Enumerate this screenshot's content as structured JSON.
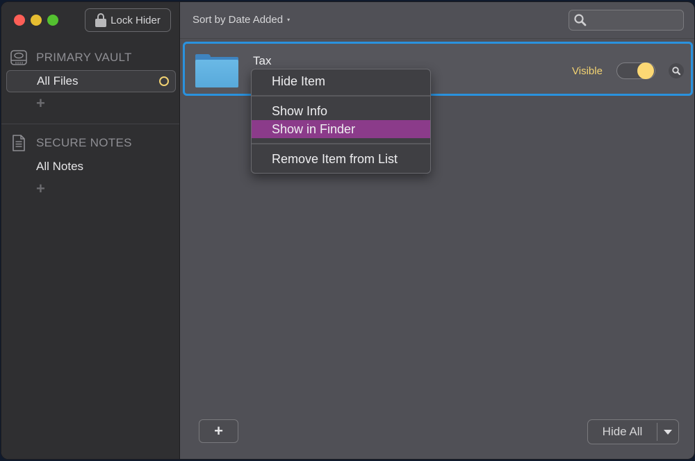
{
  "window": {
    "traffic_lights": [
      "close",
      "minimize",
      "zoom"
    ]
  },
  "toolbar": {
    "lock_label": "Lock Hider",
    "sort_label": "Sort by Date Added",
    "sort_caret": "▾",
    "search_placeholder": ""
  },
  "sidebar": {
    "sections": [
      {
        "title": "PRIMARY VAULT",
        "icon": "drive-icon",
        "items": [
          {
            "label": "All Files",
            "selected": true,
            "status": "partially-visible"
          }
        ],
        "add_label": "+"
      },
      {
        "title": "SECURE NOTES",
        "icon": "note-icon",
        "items": [
          {
            "label": "All Notes",
            "selected": false
          }
        ],
        "add_label": "+"
      }
    ]
  },
  "files": [
    {
      "name": "Tax",
      "type": "folder",
      "visibility_label": "Visible",
      "visible": true
    }
  ],
  "context_menu": {
    "items": [
      {
        "label": "Hide Item"
      },
      {
        "label": "Show Info"
      },
      {
        "label": "Show in Finder",
        "highlighted": true
      },
      {
        "label": "Remove Item from List"
      }
    ]
  },
  "footer": {
    "add_label": "+",
    "hide_all_label": "Hide All"
  },
  "colors": {
    "accent_selection": "#2a92de",
    "visible_yellow": "#f2d272",
    "menu_highlight": "#8b3b8a"
  }
}
